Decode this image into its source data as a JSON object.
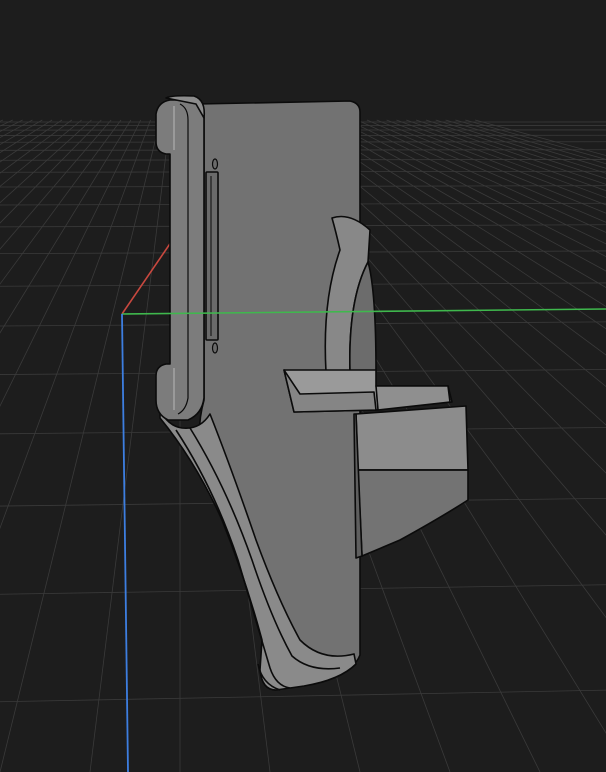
{
  "viewport": {
    "background": "#1d1d1d",
    "grid_color": "#3a3a3a",
    "grid_major_color": "#4a4a4a"
  },
  "axes": {
    "x_color": "#c8483f",
    "y_color": "#3fb84d",
    "z_color": "#3d7ee0"
  },
  "model": {
    "shape": "bracket-mount",
    "fill": "#777777",
    "fill_light": "#8e8e8e",
    "fill_dark": "#5a5a5a",
    "edge": "#0b0b0b"
  }
}
